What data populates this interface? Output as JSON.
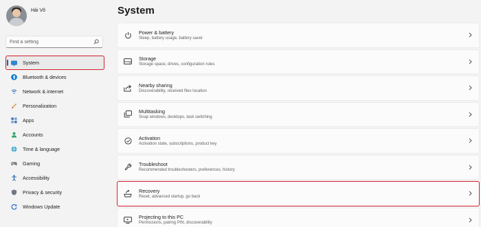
{
  "user": {
    "name": "Hải Võ"
  },
  "search": {
    "placeholder": "Find a setting"
  },
  "nav": {
    "items": [
      {
        "label": "System",
        "icon": "monitor-icon",
        "selected": true
      },
      {
        "label": "Bluetooth & devices",
        "icon": "bluetooth-icon"
      },
      {
        "label": "Network & internet",
        "icon": "wifi-icon"
      },
      {
        "label": "Personalization",
        "icon": "brush-icon"
      },
      {
        "label": "Apps",
        "icon": "apps-icon"
      },
      {
        "label": "Accounts",
        "icon": "person-icon"
      },
      {
        "label": "Time & language",
        "icon": "globe-clock-icon"
      },
      {
        "label": "Gaming",
        "icon": "gamepad-icon"
      },
      {
        "label": "Accessibility",
        "icon": "accessibility-icon"
      },
      {
        "label": "Privacy & security",
        "icon": "shield-icon"
      },
      {
        "label": "Windows Update",
        "icon": "update-icon"
      }
    ]
  },
  "main": {
    "title": "System",
    "cards": [
      {
        "title": "Power & battery",
        "desc": "Sleep, battery usage, battery saver",
        "icon": "power-icon"
      },
      {
        "title": "Storage",
        "desc": "Storage space, drives, configuration rules",
        "icon": "storage-icon"
      },
      {
        "title": "Nearby sharing",
        "desc": "Discoverability, received files location",
        "icon": "share-icon"
      },
      {
        "title": "Multitasking",
        "desc": "Snap windows, desktops, task switching",
        "icon": "multitasking-icon"
      },
      {
        "title": "Activation",
        "desc": "Activation state, subscriptions, product key",
        "icon": "check-circle-icon"
      },
      {
        "title": "Troubleshoot",
        "desc": "Recommended troubleshooters, preferences, history",
        "icon": "wrench-icon"
      },
      {
        "title": "Recovery",
        "desc": "Reset, advanced startup, go back",
        "icon": "recovery-icon",
        "highlighted": true
      },
      {
        "title": "Projecting to this PC",
        "desc": "Permissions, pairing PIN, discoverability",
        "icon": "projector-icon"
      }
    ]
  },
  "colors": {
    "accent": "#0067c0",
    "highlight": "#d11f2b"
  }
}
